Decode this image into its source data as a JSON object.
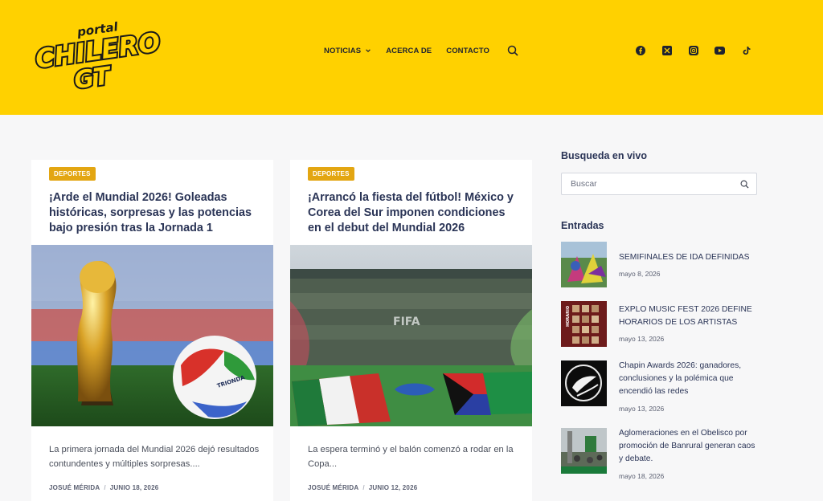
{
  "brand": {
    "logo_top": "portal",
    "logo_main": "CHILERO",
    "logo_sub": "GT",
    "color_yellow": "#ffd100",
    "color_badge": "#e3a612"
  },
  "nav": {
    "items": [
      "NOTICIAS",
      "ACERCA DE",
      "CONTACTO"
    ],
    "search_icon": "search-icon"
  },
  "socials": [
    "facebook-icon",
    "x-icon",
    "instagram-icon",
    "youtube-icon",
    "tiktok-icon"
  ],
  "articles": [
    {
      "category": "DEPORTES",
      "title": "¡Arde el Mundial 2026! Goleadas históricas, sorpresas y las potencias bajo presión tras la Jornada 1",
      "excerpt": "La primera jornada del Mundial 2026 dejó resultados contundentes y múltiples sorpresas....",
      "author": "JOSUÉ MÉRIDA",
      "date": "JUNIO 18, 2026"
    },
    {
      "category": "DEPORTES",
      "title": "¡Arrancó la fiesta del fútbol! México y Corea del Sur imponen condiciones en el debut del Mundial 2026",
      "excerpt": "La espera terminó y el balón comenzó a rodar en la Copa...",
      "author": "JOSUÉ MÉRIDA",
      "date": "JUNIO 12, 2026"
    }
  ],
  "images": {
    "ball_text": "TRIONDA",
    "stadium_text": "FIFA"
  },
  "sidebar": {
    "search_heading": "Busqueda en vivo",
    "search_placeholder": "Buscar",
    "entries_heading": "Entradas",
    "entries": [
      {
        "title": "SEMIFINALES DE IDA DEFINIDAS",
        "date": "mayo 8, 2026"
      },
      {
        "title": "EXPLO MUSIC FEST 2026 DEFINE HORARIOS DE LOS ARTISTAS",
        "date": "mayo 13, 2026",
        "thumb_text": "HORARIO"
      },
      {
        "title": "Chapin Awards 2026: ganadores, conclusiones y la polémica que encendió las redes",
        "date": "mayo 13, 2026"
      },
      {
        "title": "Aglomeraciones en el Obelisco por promoción de Banrural generan caos y debate.",
        "date": "mayo 18, 2026"
      }
    ]
  }
}
